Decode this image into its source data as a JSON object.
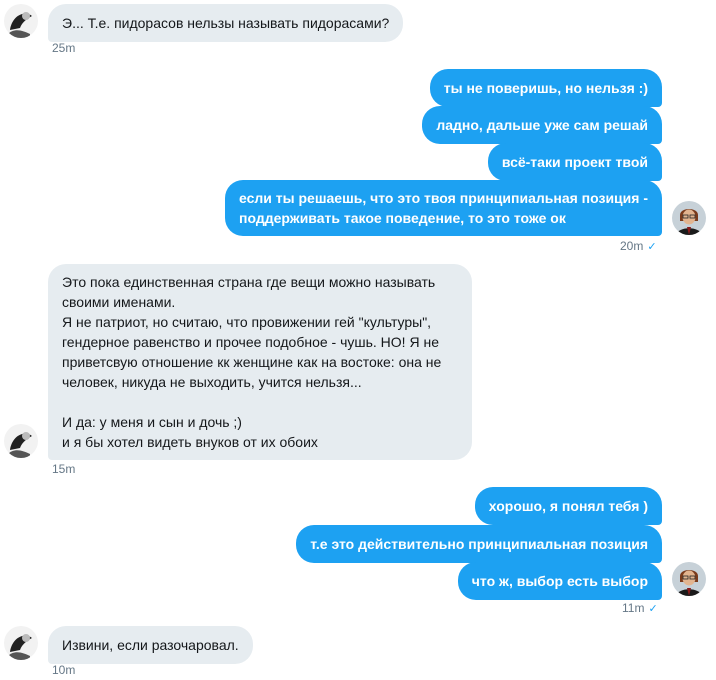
{
  "conversation": {
    "messages": [
      {
        "side": "in",
        "text": "Э... Т.е. пидорасов нельзы называть пидорасами?"
      },
      {
        "side": "out",
        "text": "ты не поверишь, но нельзя :)"
      },
      {
        "side": "out",
        "text": "ладно, дальше уже сам решай"
      },
      {
        "side": "out",
        "text": "всё-таки проект твой"
      },
      {
        "side": "out",
        "text": "если ты решаешь, что это твоя принципиальная позиция -\nподдерживать такое поведение, то это тоже ок"
      },
      {
        "side": "in",
        "text": "Это пока единственная страна где вещи можно называть\nсвоими именами.\nЯ не патриот, но считаю, что провижении гей \"культуры\",\nгендерное равенство и прочее подобное - чушь. НО! Я не\nприветсвую отношение кк женщине как на востоке: она не\nчеловек, никуда не выходить, учится нельзя...\n\nИ да: у меня и сын и дочь ;)\nи я бы хотел видеть внуков от их обоих"
      },
      {
        "side": "out",
        "text": "хорошо, я понял тебя )"
      },
      {
        "side": "out",
        "text": "т.е это действительно принципиальная позиция"
      },
      {
        "side": "out",
        "text": "что ж, выбор есть выбор"
      },
      {
        "side": "in",
        "text": "Извини, если разочаровал."
      }
    ],
    "timestamps": [
      "25m",
      "20m",
      "15m",
      "11m",
      "10m"
    ],
    "read_mark": "✓"
  },
  "colors": {
    "incoming_bubble": "#e6ecf0",
    "outgoing_bubble": "#1da1f2",
    "timestamp": "#657786"
  },
  "icons": {
    "sender_avatar": "avatar-icon",
    "user_avatar": "avatar-icon",
    "read_receipt": "checkmark-icon"
  }
}
